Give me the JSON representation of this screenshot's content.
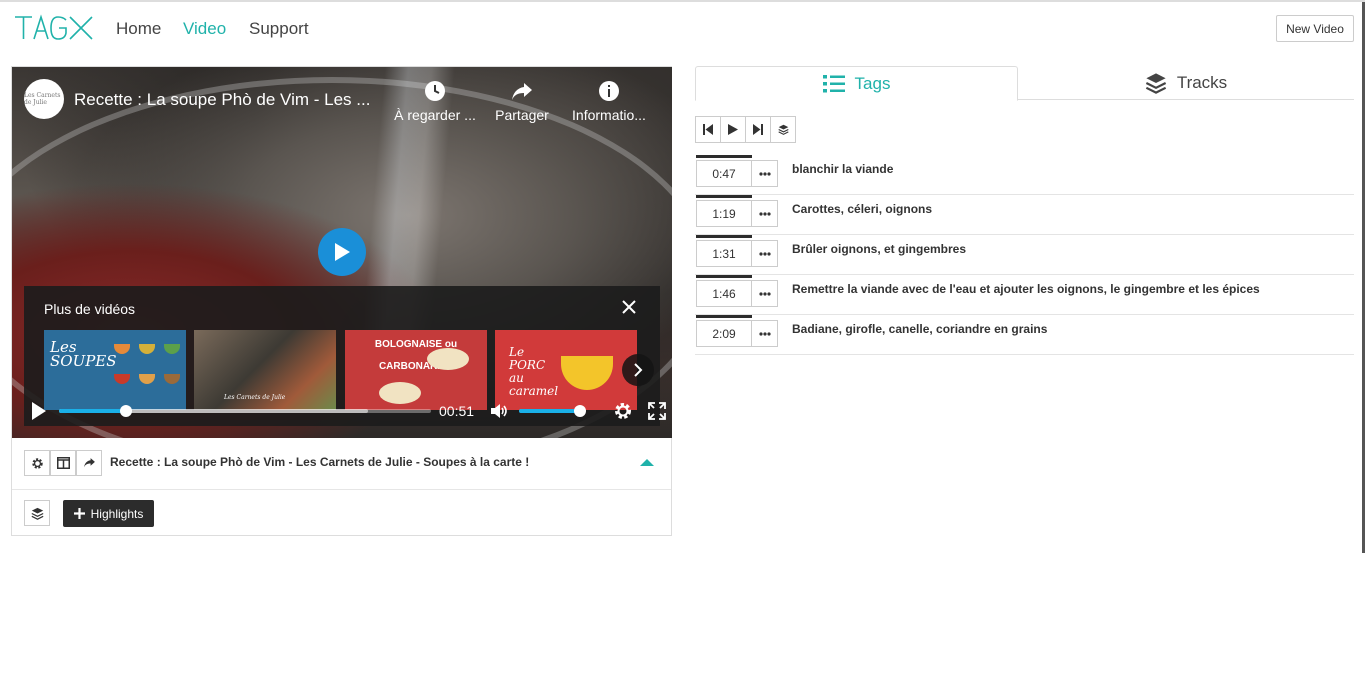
{
  "brand": {
    "logo_text": "TAGX",
    "accent_color": "#20b2aa"
  },
  "nav": {
    "items": [
      {
        "label": "Home",
        "active": false
      },
      {
        "label": "Video",
        "active": true
      },
      {
        "label": "Support",
        "active": false
      }
    ],
    "new_video_label": "New Video"
  },
  "player": {
    "channel_avatar": "Les Carnets de Julie",
    "title": "Recette : La soupe Phò de Vim - Les ...",
    "actions": [
      {
        "label": "À regarder ...",
        "icon": "clock-icon"
      },
      {
        "label": "Partager",
        "icon": "share-icon"
      },
      {
        "label": "Informatio...",
        "icon": "info-icon"
      }
    ],
    "more_videos_title": "Plus de vidéos",
    "thumbnails": [
      {
        "text": "Les SOUPES",
        "color": "#2c6d9a"
      },
      {
        "text": "Les Carnets de Julie",
        "color": "#6c5a4a"
      },
      {
        "text": "BOLOGNAISE ou CARBONARA ?",
        "color": "#c43b3b"
      },
      {
        "text": "Le PORC au caramel",
        "color": "#d13a3a"
      }
    ],
    "time": "00:51",
    "progress": 0.18,
    "buffered": 0.83,
    "volume": 0.92
  },
  "video_info": {
    "name": "Recette : La soupe Phò de Vim - Les Carnets de Julie - Soupes à la carte !",
    "highlights_label": "Highlights"
  },
  "tabs": [
    {
      "label": "Tags",
      "icon": "list-icon",
      "active": true
    },
    {
      "label": "Tracks",
      "icon": "layers-icon",
      "active": false
    }
  ],
  "tags": [
    {
      "time": "0:47",
      "label": "blanchir la viande"
    },
    {
      "time": "1:19",
      "label": "Carottes, céleri, oignons"
    },
    {
      "time": "1:31",
      "label": "Brûler oignons, et gingembres"
    },
    {
      "time": "1:46",
      "label": "Remettre la viande avec de l'eau et ajouter les oignons, le gingembre et les épices"
    },
    {
      "time": "2:09",
      "label": "Badiane, girofle, canelle, coriandre en grains"
    }
  ]
}
